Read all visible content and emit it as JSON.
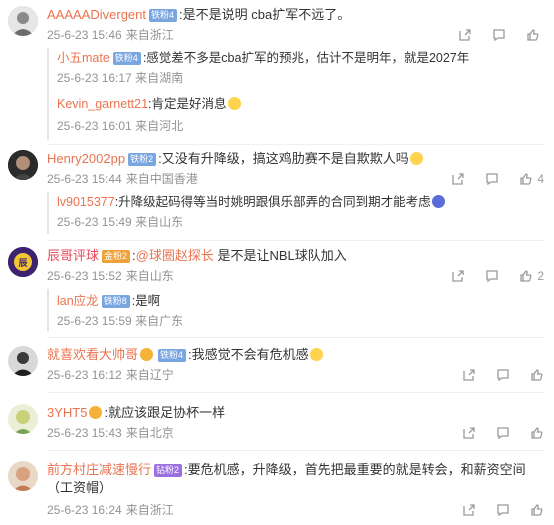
{
  "comments": [
    {
      "user": "AAAAADivergent",
      "badge": "铁粉4",
      "text": ":是不是说明 cba扩军不远了。",
      "time": "25-6-23 15:46",
      "location": "来自浙江",
      "likes": "",
      "replies": [
        {
          "user": "小五mate",
          "badge": "铁粉4",
          "text": ":感觉差不多是cba扩军的预兆，估计不是明年，就是2027年",
          "time": "25-6-23 16:17",
          "location": "来自湖南"
        },
        {
          "user": "Kevin_garnett21",
          "badge": "",
          "text": ":肯定是好消息",
          "time": "25-6-23 16:01",
          "location": "来自河北"
        }
      ]
    },
    {
      "user": "Henry2002pp",
      "badge": "铁粉2",
      "text": ":又没有升降级，搞这鸡肋赛不是自欺欺人吗",
      "time": "25-6-23 15:44",
      "location": "来自中国香港",
      "likes": "4",
      "replies": [
        {
          "user": "lv9015377",
          "badge": "",
          "text": ":升降级起码得等当时姚明跟俱乐部弄的合同到期才能考虑",
          "time": "25-6-23 15:49",
          "location": "来自山东"
        }
      ]
    },
    {
      "user": "辰哥评球",
      "badge": "金粉2",
      "text": ":@球圈赵探长 是不是让NBL球队加入",
      "time": "25-6-23 15:52",
      "location": "来自山东",
      "likes": "2",
      "replies": [
        {
          "user": "lan应龙",
          "badge": "铁粉8",
          "text": ":是啊",
          "time": "25-6-23 15:59",
          "location": "来自广东"
        }
      ]
    },
    {
      "user": "就喜欢看大帅哥",
      "badge": "铁粉4",
      "text": ":我感觉不会有危机感",
      "time": "25-6-23 16:12",
      "location": "来自辽宁",
      "likes": "",
      "replies": []
    },
    {
      "user": "3YHT5",
      "badge": "",
      "text": ":就应该跟足协杯一样",
      "time": "25-6-23 15:43",
      "location": "来自北京",
      "likes": "",
      "replies": []
    },
    {
      "user": "前方村庄减速慢行",
      "badge": "钻粉2",
      "text": ":要危机感，升降级，首先把最重要的就是转会，和薪资空间（工资帽）",
      "time": "25-6-23 16:24",
      "location": "来自浙江",
      "likes": "",
      "replies": []
    }
  ],
  "mention": "@球圈赵探长",
  "icons": [
    "share-icon",
    "comment-icon",
    "like-icon",
    "heart-avatar"
  ]
}
